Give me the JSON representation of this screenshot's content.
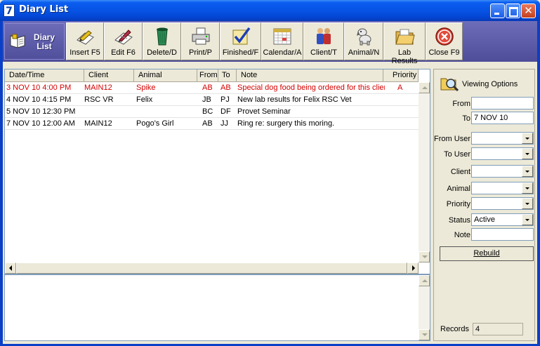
{
  "window": {
    "title": "Diary List",
    "app_icon": "7"
  },
  "toolbar": {
    "badge_line1": "Diary",
    "badge_line2": "List",
    "buttons": [
      {
        "label": "Insert F5",
        "icon": "pencil-paper-icon"
      },
      {
        "label": "Edit F6",
        "icon": "edit-pen-icon"
      },
      {
        "label": "Delete/D",
        "icon": "trash-bin-icon"
      },
      {
        "label": "Print/P",
        "icon": "printer-icon"
      },
      {
        "label": "Finished/F",
        "icon": "checkmark-icon"
      },
      {
        "label": "Calendar/A",
        "icon": "calendar-icon"
      },
      {
        "label": "Client/T",
        "icon": "people-icon"
      },
      {
        "label": "Animal/N",
        "icon": "dog-icon"
      },
      {
        "label": "Lab Results",
        "icon": "folder-icon"
      },
      {
        "label": "Close F9",
        "icon": "close-circle-icon"
      }
    ]
  },
  "grid": {
    "columns": [
      "Date/Time",
      "Client",
      "Animal",
      "From",
      "To",
      "Note",
      "Priority"
    ],
    "rows": [
      {
        "datetime": "3 NOV 10  4:00 PM",
        "client": "MAIN12",
        "animal": "Spike",
        "from": "AB",
        "to": "AB",
        "note": "Special dog food being ordered for this client",
        "priority": "A",
        "highlight": true
      },
      {
        "datetime": "4 NOV 10  4:15 PM",
        "client": "RSC VR",
        "animal": "Felix",
        "from": "JB",
        "to": "PJ",
        "note": "New lab results for Felix RSC Vet",
        "priority": "",
        "highlight": false
      },
      {
        "datetime": "5 NOV 10  12:30 PM",
        "client": "",
        "animal": "",
        "from": "BC",
        "to": "DF",
        "note": "Provet Seminar",
        "priority": "",
        "highlight": false
      },
      {
        "datetime": "7 NOV 10  12:00 AM",
        "client": "MAIN12",
        "animal": "Pogo's Girl",
        "from": "AB",
        "to": "JJ",
        "note": "Ring re: surgery this moring.",
        "priority": "",
        "highlight": false
      }
    ],
    "highlight_color": "#d40000"
  },
  "options": {
    "title": "Viewing Options",
    "from_label": "From",
    "from_value": "",
    "to_label": "To",
    "to_value": "7 NOV 10",
    "from_user_label": "From User",
    "from_user_value": "",
    "to_user_label": "To User",
    "to_user_value": "",
    "client_label": "Client",
    "client_value": "",
    "animal_label": "Animal",
    "animal_value": "",
    "priority_label": "Priority",
    "priority_value": "",
    "status_label": "Status",
    "status_value": "Active",
    "note_label": "Note",
    "note_value": "",
    "rebuild_label": "Rebuild",
    "records_label": "Records",
    "records_value": "4"
  }
}
